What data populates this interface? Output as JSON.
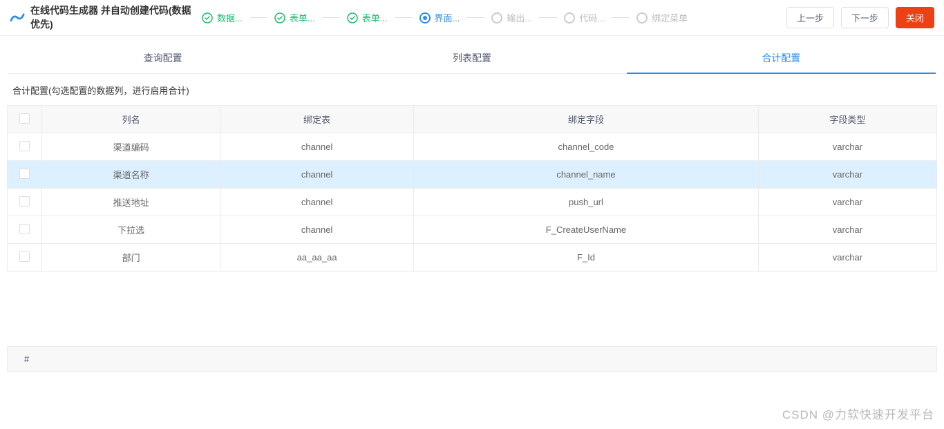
{
  "header": {
    "title": "在线代码生成器 并自动创建代码(数据优先)",
    "buttons": {
      "prev": "上一步",
      "next": "下一步",
      "close": "关闭"
    }
  },
  "steps": [
    {
      "label": "数据...",
      "state": "done"
    },
    {
      "label": "表单...",
      "state": "done"
    },
    {
      "label": "表单...",
      "state": "done"
    },
    {
      "label": "界面...",
      "state": "active"
    },
    {
      "label": "输出...",
      "state": "pending"
    },
    {
      "label": "代码...",
      "state": "pending"
    },
    {
      "label": "绑定菜单",
      "state": "pending"
    }
  ],
  "tabs": [
    {
      "label": "查询配置",
      "active": false
    },
    {
      "label": "列表配置",
      "active": false
    },
    {
      "label": "合计配置",
      "active": true
    }
  ],
  "sectionTitle": "合计配置(勾选配置的数据列，进行启用合计)",
  "table": {
    "headers": [
      "列名",
      "绑定表",
      "绑定字段",
      "字段类型"
    ],
    "rows": [
      {
        "name": "渠道编码",
        "table": "channel",
        "field": "channel_code",
        "type": "varchar",
        "selected": false
      },
      {
        "name": "渠道名称",
        "table": "channel",
        "field": "channel_name",
        "type": "varchar",
        "selected": true
      },
      {
        "name": "推送地址",
        "table": "channel",
        "field": "push_url",
        "type": "varchar",
        "selected": false
      },
      {
        "name": "下拉选",
        "table": "channel",
        "field": "F_CreateUserName",
        "type": "varchar",
        "selected": false
      },
      {
        "name": "部门",
        "table": "aa_aa_aa",
        "field": "F_Id",
        "type": "varchar",
        "selected": false
      }
    ]
  },
  "hashLabel": "#",
  "watermark": "CSDN @力软快速开发平台"
}
